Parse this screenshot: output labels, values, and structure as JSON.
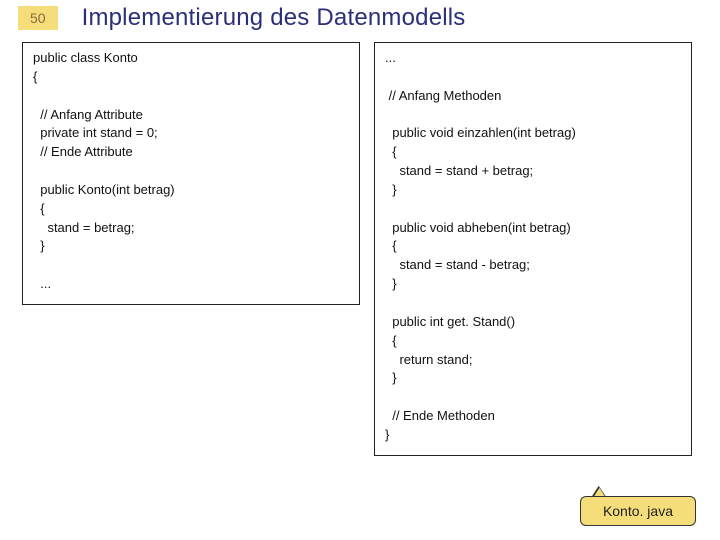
{
  "page_number": "50",
  "title": "Implementierung des Datenmodells",
  "left_code": "public class Konto\n{\n\n  // Anfang Attribute\n  private int stand = 0;\n  // Ende Attribute\n\n  public Konto(int betrag)\n  {\n    stand = betrag;\n  }\n\n  ...",
  "right_code": "...\n\n // Anfang Methoden\n\n  public void einzahlen(int betrag)\n  {\n    stand = stand + betrag;\n  }\n\n  public void abheben(int betrag)\n  {\n    stand = stand - betrag;\n  }\n\n  public int get. Stand()\n  {\n    return stand;\n  }\n\n  // Ende Methoden\n}",
  "callout": "Konto. java"
}
